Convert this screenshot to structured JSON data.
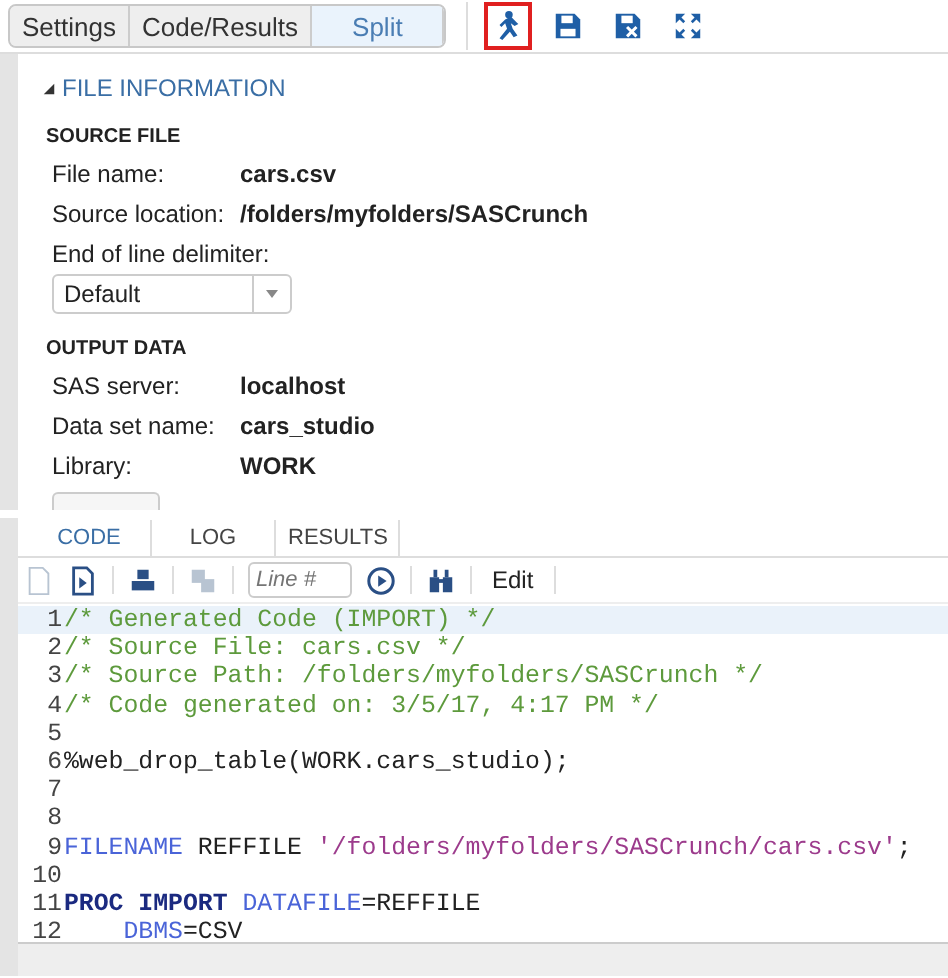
{
  "view_tabs": [
    {
      "label": "Settings",
      "selected": false
    },
    {
      "label": "Code/Results",
      "selected": false
    },
    {
      "label": "Split",
      "selected": true
    }
  ],
  "toolbar_icons": [
    {
      "kind": "run",
      "highlighted": true
    },
    {
      "kind": "save"
    },
    {
      "kind": "save-as"
    },
    {
      "kind": "maximize"
    }
  ],
  "file_information": {
    "title": "FILE INFORMATION",
    "expanded": true,
    "source_file": {
      "title": "SOURCE FILE",
      "fields": [
        {
          "label": "File name:",
          "value": "cars.csv"
        },
        {
          "label": "Source location:",
          "value": "/folders/myfolders/SASCrunch"
        }
      ],
      "delimiter": {
        "label": "End of line delimiter:",
        "value": "Default"
      }
    },
    "output_data": {
      "title": "OUTPUT DATA",
      "fields": [
        {
          "label": "SAS server:",
          "value": "localhost"
        },
        {
          "label": "Data set name:",
          "value": "cars_studio"
        },
        {
          "label": "Library:",
          "value": "WORK"
        }
      ]
    }
  },
  "code_tabs": [
    {
      "label": "CODE",
      "selected": true
    },
    {
      "label": "LOG",
      "selected": false
    },
    {
      "label": "RESULTS",
      "selected": false
    }
  ],
  "code_toolbar": {
    "line_field": {
      "placeholder": "Line #"
    },
    "edit_button": "Edit",
    "icons": [
      {
        "kind": "document",
        "disabled": true
      },
      {
        "kind": "document-arrow",
        "disabled": false
      },
      {
        "kind": "printer",
        "disabled": false
      },
      {
        "kind": "copy",
        "disabled": true
      }
    ]
  },
  "code_lines": [
    {
      "number": "1",
      "current": true,
      "tokens": [
        {
          "kind": "comment",
          "text": "/* Generated Code (IMPORT) */"
        }
      ]
    },
    {
      "number": "2",
      "current": false,
      "tokens": [
        {
          "kind": "comment",
          "text": "/* Source File: cars.csv */"
        }
      ]
    },
    {
      "number": "3",
      "current": false,
      "tokens": [
        {
          "kind": "comment",
          "text": "/* Source Path: /folders/myfolders/SASCrunch */"
        }
      ]
    },
    {
      "number": "4",
      "current": false,
      "tokens": [
        {
          "kind": "comment",
          "text": "/* Code generated on: 3/5/17, 4:17 PM */"
        }
      ]
    },
    {
      "number": "5",
      "current": false
    },
    {
      "number": "6",
      "current": false,
      "tokens": [
        {
          "kind": "plain",
          "text": "%web_drop_table(WORK.cars_studio);"
        }
      ]
    },
    {
      "number": "7",
      "current": false
    },
    {
      "number": "8",
      "current": false
    },
    {
      "number": "9",
      "current": false,
      "tokens": [
        {
          "kind": "keyword",
          "text": "FILENAME"
        },
        {
          "kind": "plain",
          "text": " REFFILE "
        },
        {
          "kind": "string",
          "text": "'/folders/myfolders/SASCrunch/cars.csv'"
        },
        {
          "kind": "plain",
          "text": ";"
        }
      ]
    },
    {
      "number": "10",
      "current": false
    },
    {
      "number": "11",
      "current": false,
      "tokens": [
        {
          "kind": "proc",
          "text": "PROC IMPORT"
        },
        {
          "kind": "keyword",
          "text": "DATAFILE",
          "space_before": true
        },
        {
          "kind": "plain",
          "text": "=REFFILE"
        }
      ]
    },
    {
      "number": "12",
      "current": false,
      "indented": true,
      "tokens": [
        {
          "kind": "keyword",
          "text": "DBMS"
        },
        {
          "kind": "plain",
          "text": "=CSV"
        }
      ]
    }
  ]
}
